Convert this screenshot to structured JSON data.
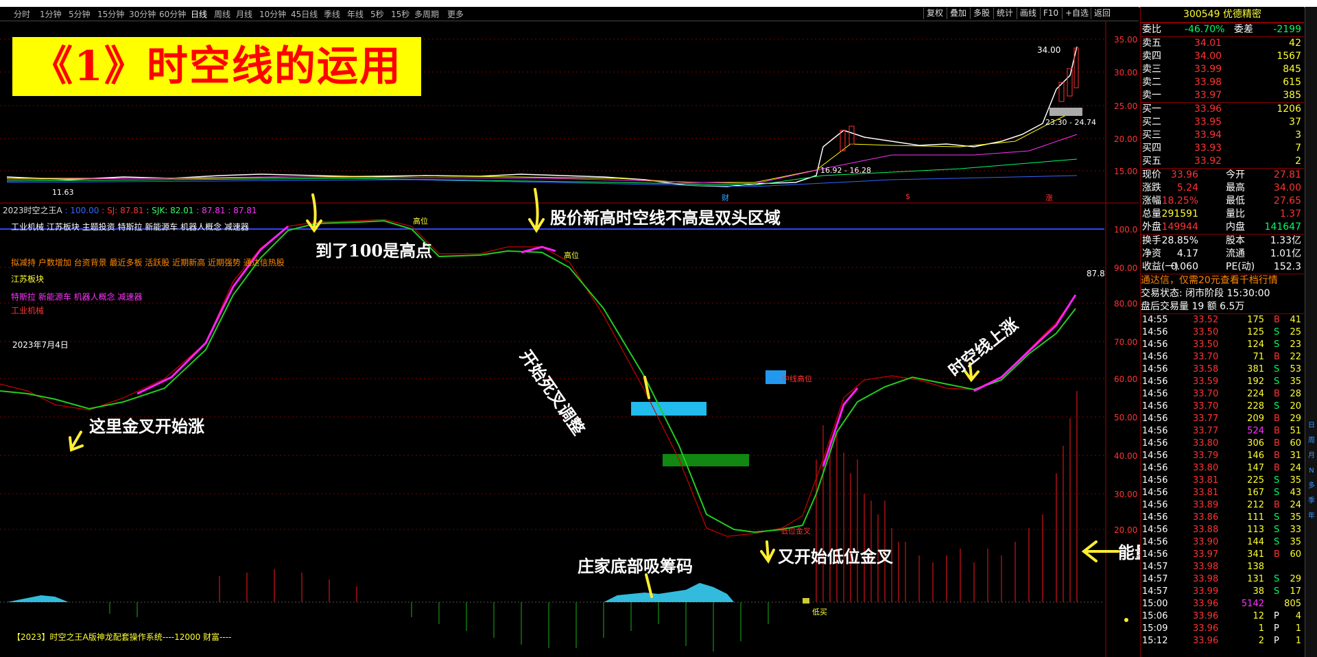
{
  "toolbar": {
    "periods": [
      "分时",
      "1分钟",
      "5分钟",
      "15分钟",
      "30分钟",
      "60分钟",
      "日线",
      "周线",
      "月线",
      "10分钟",
      "45日线",
      "季线",
      "年线",
      "5秒",
      "15秒",
      "多周期",
      "更多"
    ],
    "active": "日线",
    "tools": [
      "复权",
      "叠加",
      "多股",
      "统计",
      "画线",
      "F10",
      "+自选",
      "返回"
    ]
  },
  "title_banner": "《1》时空线的运用",
  "price_chart": {
    "y_ticks": [
      "35.00",
      "30.00",
      "25.00",
      "20.00",
      "15.00"
    ],
    "label_top": "34.00",
    "label_range1": "23.30 - 24.74",
    "label_range2": "16.92 - 16.28",
    "label_low": "11.63",
    "mark_cai": "财",
    "mark_s": "$",
    "mark_zhang": "涨"
  },
  "indicator": {
    "header_name": "2023时空之王A",
    "header_vals": [
      ": 100.00",
      ": SJ: 87.81",
      ": SJK: 82.01",
      ": 87.81",
      ": 87.81"
    ],
    "line_100_label": "工业机械 江苏板块 主题投资 特斯拉 新能源车 机器人概念 减速器",
    "sector_line1": "拟减持 户数增加 台资背景 最近多板 活跃股 近期新高 近期强势 通达信热股",
    "sector_line2": "江苏板块",
    "sector_line3": "特斯拉 新能源车 机器人概念 减速器",
    "sector_line4": "工业机械",
    "date": "2023年7月4日",
    "y_ticks": [
      "100.0",
      "90.00",
      "80.00",
      "70.00",
      "60.00",
      "50.00",
      "40.00",
      "30.00",
      "20.00"
    ],
    "current_value": "87.8",
    "tag_gaowei1": "高位",
    "tag_gaowei2": "高位",
    "tag_zhongxian": "中线高位",
    "tag_diwei": "低位金叉",
    "tag_dimai": "低买",
    "footer": "【2023】时空之王A版神龙配套操作系统----12000 财富----"
  },
  "annotations": {
    "a1": "这里金叉开始涨",
    "a2": "到了100是高点",
    "a3": "股价新高时空线不高是双头区域",
    "a4": "开始死叉调整",
    "a5": "庄家底部吸筹码",
    "a6": "又开始低位金叉",
    "a7": "时空线上涨",
    "a8": "能量控盘"
  },
  "stock": {
    "code_name": "300549 优德精密",
    "weibi_label": "委比",
    "weibi": "-46.70%",
    "weicha_label": "委差",
    "weicha": "-2199",
    "asks": [
      {
        "label": "卖五",
        "price": "34.01",
        "vol": "42"
      },
      {
        "label": "卖四",
        "price": "34.00",
        "vol": "1567"
      },
      {
        "label": "卖三",
        "price": "33.99",
        "vol": "845"
      },
      {
        "label": "卖二",
        "price": "33.98",
        "vol": "615"
      },
      {
        "label": "卖一",
        "price": "33.97",
        "vol": "385"
      }
    ],
    "bids": [
      {
        "label": "买一",
        "price": "33.96",
        "vol": "1206"
      },
      {
        "label": "买二",
        "price": "33.95",
        "vol": "37"
      },
      {
        "label": "买三",
        "price": "33.94",
        "vol": "3"
      },
      {
        "label": "买四",
        "price": "33.93",
        "vol": "7"
      },
      {
        "label": "买五",
        "price": "33.92",
        "vol": "2"
      }
    ],
    "quote": [
      {
        "l1": "现价",
        "v1": "33.96",
        "l2": "今开",
        "v2": "27.81"
      },
      {
        "l1": "涨跌",
        "v1": "5.24",
        "l2": "最高",
        "v2": "34.00"
      },
      {
        "l1": "涨幅",
        "v1": "18.25%",
        "l2": "最低",
        "v2": "27.65"
      },
      {
        "l1": "总量",
        "v1": "291591",
        "l2": "量比",
        "v2": "1.37"
      },
      {
        "l1": "外盘",
        "v1": "149944",
        "l2": "内盘",
        "v2": "141647"
      }
    ],
    "stats": [
      {
        "l1": "换手",
        "v1": "28.85%",
        "l2": "股本",
        "v2": "1.33亿"
      },
      {
        "l1": "净资",
        "v1": "4.17",
        "l2": "流通",
        "v2": "1.01亿"
      },
      {
        "l1": "收益(一)",
        "v1": "0.060",
        "l2": "PE(动)",
        "v2": "152.3"
      }
    ],
    "promo": "通达信，仅需20元查看千档行情",
    "status": "交易状态: 闭市阶段 15:30:00",
    "after": "盘后交易量 19 额 6.5万"
  },
  "trades": [
    [
      "14:55",
      "33.52",
      "175",
      "B",
      "41"
    ],
    [
      "14:56",
      "33.50",
      "125",
      "S",
      "25"
    ],
    [
      "14:56",
      "33.50",
      "124",
      "S",
      "23"
    ],
    [
      "14:56",
      "33.70",
      "71",
      "B",
      "22"
    ],
    [
      "14:56",
      "33.58",
      "381",
      "S",
      "53"
    ],
    [
      "14:56",
      "33.59",
      "192",
      "S",
      "35"
    ],
    [
      "14:56",
      "33.70",
      "224",
      "B",
      "28"
    ],
    [
      "14:56",
      "33.70",
      "228",
      "S",
      "20"
    ],
    [
      "14:56",
      "33.77",
      "209",
      "B",
      "29"
    ],
    [
      "14:56",
      "33.77",
      "524",
      "B",
      "51"
    ],
    [
      "14:56",
      "33.80",
      "306",
      "B",
      "60"
    ],
    [
      "14:56",
      "33.79",
      "146",
      "B",
      "31"
    ],
    [
      "14:56",
      "33.80",
      "147",
      "B",
      "24"
    ],
    [
      "14:56",
      "33.81",
      "225",
      "S",
      "35"
    ],
    [
      "14:56",
      "33.81",
      "167",
      "S",
      "43"
    ],
    [
      "14:56",
      "33.89",
      "212",
      "B",
      "24"
    ],
    [
      "14:56",
      "33.86",
      "111",
      "S",
      "35"
    ],
    [
      "14:56",
      "33.88",
      "113",
      "S",
      "33"
    ],
    [
      "14:56",
      "33.90",
      "144",
      "S",
      "35"
    ],
    [
      "14:56",
      "33.97",
      "341",
      "B",
      "60"
    ],
    [
      "14:57",
      "33.98",
      "138",
      "",
      ""
    ],
    [
      "14:57",
      "33.98",
      "131",
      "S",
      "29"
    ],
    [
      "14:57",
      "33.99",
      "38",
      "S",
      "17"
    ],
    [
      "15:00",
      "33.96",
      "5142",
      "",
      "805"
    ],
    [
      "15:06",
      "33.96",
      "12",
      "P",
      "4"
    ],
    [
      "15:09",
      "33.96",
      "1",
      "P",
      "1"
    ],
    [
      "15:12",
      "33.96",
      "2",
      "P",
      "1"
    ]
  ],
  "side_tabs": [
    "日",
    "周",
    "月",
    "N",
    "多",
    "季",
    "年"
  ]
}
